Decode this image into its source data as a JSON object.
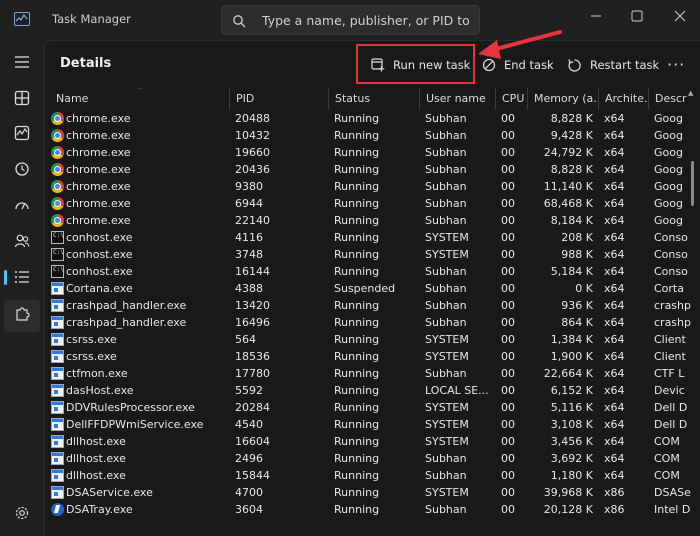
{
  "window": {
    "title": "Task Manager",
    "search_placeholder": "Type a name, publisher, or PID to se..."
  },
  "sidebar": {
    "items": [
      {
        "name": "hamburger-menu-icon"
      },
      {
        "name": "processes-icon"
      },
      {
        "name": "performance-icon"
      },
      {
        "name": "app-history-icon"
      },
      {
        "name": "startup-apps-icon"
      },
      {
        "name": "users-icon"
      },
      {
        "name": "details-icon",
        "active": true
      },
      {
        "name": "services-icon"
      },
      {
        "name": "settings-icon"
      }
    ]
  },
  "toolbar": {
    "title": "Details",
    "run_new_task": "Run new task",
    "end_task": "End task",
    "restart_task": "Restart task",
    "more": "···"
  },
  "colors": {
    "highlight": "#e3363c",
    "accent": "#4cc2ff",
    "background": "#191919"
  },
  "table": {
    "columns": [
      "Name",
      "PID",
      "Status",
      "User name",
      "CPU",
      "Memory (a...",
      "Archite...",
      "Descr"
    ],
    "rows": [
      {
        "icon": "chrome",
        "name": "chrome.exe",
        "pid": "20488",
        "status": "Running",
        "user": "Subhan",
        "cpu": "00",
        "mem": "8,828 K",
        "arch": "x64",
        "desc": "Goog"
      },
      {
        "icon": "chrome",
        "name": "chrome.exe",
        "pid": "10432",
        "status": "Running",
        "user": "Subhan",
        "cpu": "00",
        "mem": "9,428 K",
        "arch": "x64",
        "desc": "Goog"
      },
      {
        "icon": "chrome",
        "name": "chrome.exe",
        "pid": "19660",
        "status": "Running",
        "user": "Subhan",
        "cpu": "00",
        "mem": "24,792 K",
        "arch": "x64",
        "desc": "Goog"
      },
      {
        "icon": "chrome",
        "name": "chrome.exe",
        "pid": "20436",
        "status": "Running",
        "user": "Subhan",
        "cpu": "00",
        "mem": "8,828 K",
        "arch": "x64",
        "desc": "Goog"
      },
      {
        "icon": "chrome",
        "name": "chrome.exe",
        "pid": "9380",
        "status": "Running",
        "user": "Subhan",
        "cpu": "00",
        "mem": "11,140 K",
        "arch": "x64",
        "desc": "Goog"
      },
      {
        "icon": "chrome",
        "name": "chrome.exe",
        "pid": "6944",
        "status": "Running",
        "user": "Subhan",
        "cpu": "00",
        "mem": "68,468 K",
        "arch": "x64",
        "desc": "Goog"
      },
      {
        "icon": "chrome",
        "name": "chrome.exe",
        "pid": "22140",
        "status": "Running",
        "user": "Subhan",
        "cpu": "00",
        "mem": "8,184 K",
        "arch": "x64",
        "desc": "Goog"
      },
      {
        "icon": "console",
        "name": "conhost.exe",
        "pid": "4116",
        "status": "Running",
        "user": "SYSTEM",
        "cpu": "00",
        "mem": "208 K",
        "arch": "x64",
        "desc": "Conso"
      },
      {
        "icon": "console",
        "name": "conhost.exe",
        "pid": "3748",
        "status": "Running",
        "user": "SYSTEM",
        "cpu": "00",
        "mem": "988 K",
        "arch": "x64",
        "desc": "Conso"
      },
      {
        "icon": "console",
        "name": "conhost.exe",
        "pid": "16144",
        "status": "Running",
        "user": "Subhan",
        "cpu": "00",
        "mem": "5,184 K",
        "arch": "x64",
        "desc": "Conso"
      },
      {
        "icon": "window",
        "name": "Cortana.exe",
        "pid": "4388",
        "status": "Suspended",
        "user": "Subhan",
        "cpu": "00",
        "mem": "0 K",
        "arch": "x64",
        "desc": "Corta"
      },
      {
        "icon": "window",
        "name": "crashpad_handler.exe",
        "pid": "13420",
        "status": "Running",
        "user": "Subhan",
        "cpu": "00",
        "mem": "936 K",
        "arch": "x64",
        "desc": "crashp"
      },
      {
        "icon": "window",
        "name": "crashpad_handler.exe",
        "pid": "16496",
        "status": "Running",
        "user": "Subhan",
        "cpu": "00",
        "mem": "864 K",
        "arch": "x64",
        "desc": "crashp"
      },
      {
        "icon": "window",
        "name": "csrss.exe",
        "pid": "564",
        "status": "Running",
        "user": "SYSTEM",
        "cpu": "00",
        "mem": "1,384 K",
        "arch": "x64",
        "desc": "Client"
      },
      {
        "icon": "window",
        "name": "csrss.exe",
        "pid": "18536",
        "status": "Running",
        "user": "SYSTEM",
        "cpu": "00",
        "mem": "1,900 K",
        "arch": "x64",
        "desc": "Client"
      },
      {
        "icon": "window",
        "name": "ctfmon.exe",
        "pid": "17780",
        "status": "Running",
        "user": "Subhan",
        "cpu": "00",
        "mem": "22,664 K",
        "arch": "x64",
        "desc": "CTF L"
      },
      {
        "icon": "window",
        "name": "dasHost.exe",
        "pid": "5592",
        "status": "Running",
        "user": "LOCAL SE...",
        "cpu": "00",
        "mem": "6,152 K",
        "arch": "x64",
        "desc": "Devic"
      },
      {
        "icon": "window",
        "name": "DDVRulesProcessor.exe",
        "pid": "20284",
        "status": "Running",
        "user": "SYSTEM",
        "cpu": "00",
        "mem": "5,116 K",
        "arch": "x64",
        "desc": "Dell D"
      },
      {
        "icon": "window",
        "name": "DellFFDPWmiService.exe",
        "pid": "4540",
        "status": "Running",
        "user": "SYSTEM",
        "cpu": "00",
        "mem": "3,108 K",
        "arch": "x64",
        "desc": "Dell D"
      },
      {
        "icon": "window",
        "name": "dllhost.exe",
        "pid": "16604",
        "status": "Running",
        "user": "SYSTEM",
        "cpu": "00",
        "mem": "3,456 K",
        "arch": "x64",
        "desc": "COM"
      },
      {
        "icon": "window",
        "name": "dllhost.exe",
        "pid": "2496",
        "status": "Running",
        "user": "Subhan",
        "cpu": "00",
        "mem": "3,692 K",
        "arch": "x64",
        "desc": "COM"
      },
      {
        "icon": "window",
        "name": "dllhost.exe",
        "pid": "15844",
        "status": "Running",
        "user": "Subhan",
        "cpu": "00",
        "mem": "1,180 K",
        "arch": "x64",
        "desc": "COM"
      },
      {
        "icon": "window",
        "name": "DSAService.exe",
        "pid": "4700",
        "status": "Running",
        "user": "SYSTEM",
        "cpu": "00",
        "mem": "39,968 K",
        "arch": "x86",
        "desc": "DSASe"
      },
      {
        "icon": "dsa",
        "name": "DSATray.exe",
        "pid": "3604",
        "status": "Running",
        "user": "Subhan",
        "cpu": "00",
        "mem": "20,128 K",
        "arch": "x86",
        "desc": "Intel D"
      }
    ]
  }
}
